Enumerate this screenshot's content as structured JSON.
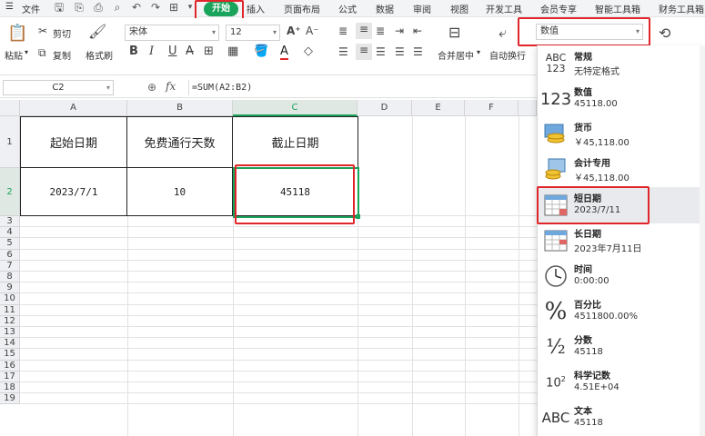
{
  "menu": {
    "file": "文件",
    "tabs": [
      "开始",
      "插入",
      "页面布局",
      "公式",
      "数据",
      "审阅",
      "视图",
      "开发工具",
      "会员专享",
      "智能工具箱",
      "财务工具箱"
    ]
  },
  "ribbon": {
    "paste": "粘贴",
    "cut": "剪切",
    "copy": "复制",
    "format_painter": "格式刷",
    "font_name": "宋体",
    "font_size": "12",
    "bold": "B",
    "italic": "I",
    "underline": "U",
    "merge_center": "合并居中",
    "wrap_text": "自动换行",
    "number_format": "数值"
  },
  "formula_bar": {
    "name_box": "C2",
    "fx": "fx",
    "formula": "=SUM(A2:B2)"
  },
  "sheet": {
    "columns": [
      "A",
      "B",
      "C",
      "D",
      "E",
      "F"
    ],
    "rows": [
      "1",
      "2",
      "3",
      "4",
      "5",
      "6",
      "7",
      "8",
      "9",
      "10",
      "11",
      "12",
      "13",
      "14",
      "15",
      "16",
      "17",
      "18",
      "19"
    ],
    "row1": [
      "起始日期",
      "免费通行天数",
      "截止日期"
    ],
    "row2": [
      "2023/7/1",
      "10",
      "45118"
    ]
  },
  "format_menu": [
    {
      "icon": "abc-123-icon",
      "name": "常规",
      "sample": "无特定格式"
    },
    {
      "icon": "number-123-icon",
      "name": "数值",
      "sample": "45118.00"
    },
    {
      "icon": "currency-coins-icon",
      "name": "货币",
      "sample": "￥45,118.00"
    },
    {
      "icon": "accounting-coins-icon",
      "name": "会计专用",
      "sample": "￥45,118.00"
    },
    {
      "icon": "calendar-icon",
      "name": "短日期",
      "sample": "2023/7/11"
    },
    {
      "icon": "calendar-long-icon",
      "name": "长日期",
      "sample": "2023年7月11日"
    },
    {
      "icon": "clock-icon",
      "name": "时间",
      "sample": "0:00:00"
    },
    {
      "icon": "percent-icon",
      "name": "百分比",
      "sample": "4511800.00%"
    },
    {
      "icon": "fraction-icon",
      "name": "分数",
      "sample": "45118"
    },
    {
      "icon": "scientific-icon",
      "name": "科学记数",
      "sample": "4.51E+04"
    },
    {
      "icon": "text-abc-icon",
      "name": "文本",
      "sample": "45118"
    }
  ],
  "colors": {
    "accent": "#1aa35a",
    "highlight_red": "#e0262a"
  }
}
